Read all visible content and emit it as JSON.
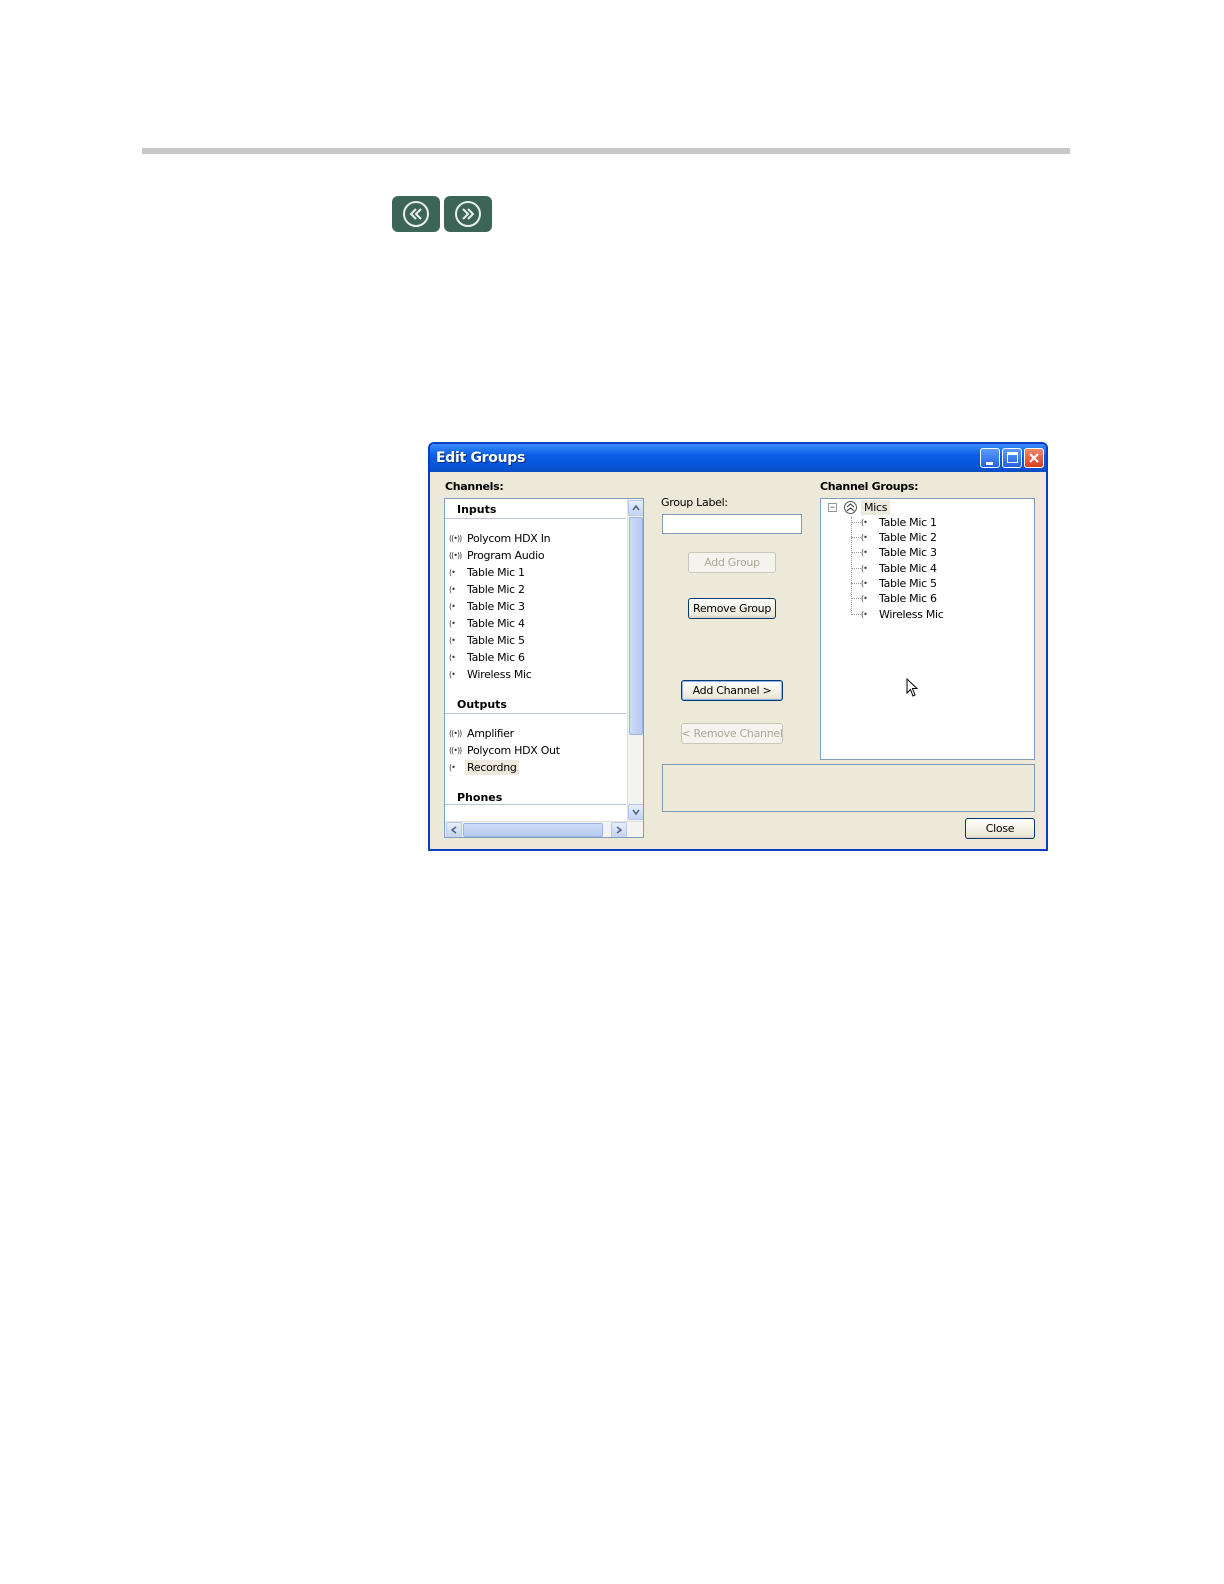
{
  "window": {
    "title": "Edit Groups"
  },
  "channels": {
    "label": "Channels:",
    "sections": [
      {
        "heading": "Inputs",
        "items": [
          {
            "icon": "stereo-channel-icon",
            "glyph": "((•))",
            "label": "Polycom HDX In"
          },
          {
            "icon": "stereo-channel-icon",
            "glyph": "((•))",
            "label": "Program Audio"
          },
          {
            "icon": "mono-channel-icon",
            "glyph": "(•",
            "label": "Table Mic 1"
          },
          {
            "icon": "mono-channel-icon",
            "glyph": "(•",
            "label": "Table Mic 2"
          },
          {
            "icon": "mono-channel-icon",
            "glyph": "(•",
            "label": "Table Mic 3"
          },
          {
            "icon": "mono-channel-icon",
            "glyph": "(•",
            "label": "Table Mic 4"
          },
          {
            "icon": "mono-channel-icon",
            "glyph": "(•",
            "label": "Table Mic 5"
          },
          {
            "icon": "mono-channel-icon",
            "glyph": "(•",
            "label": "Table Mic 6"
          },
          {
            "icon": "mono-channel-icon",
            "glyph": "(•",
            "label": "Wireless Mic"
          }
        ]
      },
      {
        "heading": "Outputs",
        "items": [
          {
            "icon": "stereo-channel-icon",
            "glyph": "((•))",
            "label": "Amplifier"
          },
          {
            "icon": "stereo-channel-icon",
            "glyph": "((•))",
            "label": "Polycom HDX Out"
          },
          {
            "icon": "mono-channel-icon",
            "glyph": "(•",
            "label": "Recordng",
            "selected": true
          }
        ]
      },
      {
        "heading": "Phones",
        "items": []
      }
    ]
  },
  "group_label": {
    "label": "Group Label:",
    "value": ""
  },
  "buttons": {
    "add_group": "Add Group",
    "remove_group": "Remove Group",
    "add_channel": "Add Channel >",
    "remove_channel": "< Remove Channel",
    "close": "Close"
  },
  "channel_groups": {
    "label": "Channel Groups:",
    "groups": [
      {
        "name": "Mics",
        "expander": "−",
        "items": [
          "Table Mic 1",
          "Table Mic 2",
          "Table Mic 3",
          "Table Mic 4",
          "Table Mic 5",
          "Table Mic 6",
          "Wireless Mic"
        ]
      }
    ]
  },
  "nav": {
    "prev_icon": "double-chevron-left-icon",
    "next_icon": "double-chevron-right-icon"
  },
  "colors": {
    "titlebar": "#0a5ee8",
    "nav_button": "#3d6557",
    "dialog_bg": "#ece9d8"
  }
}
